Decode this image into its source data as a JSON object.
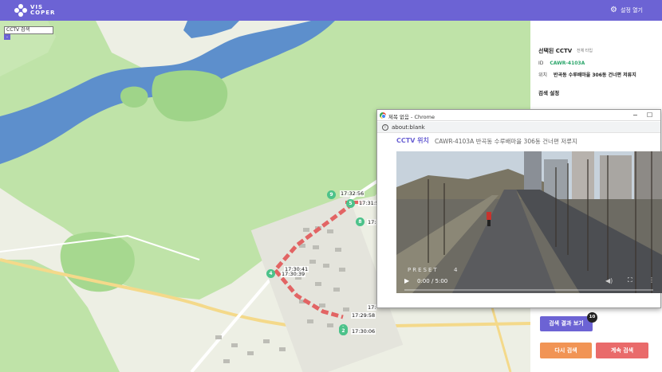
{
  "header": {
    "logo_line1": "VIS",
    "logo_line2": "COPER",
    "settings_label": "설정 열기"
  },
  "map": {
    "search_value": "CCTV 검색",
    "search_button": "-",
    "markers": [
      "9",
      "5",
      "8",
      "4",
      "3",
      "1",
      "2"
    ],
    "time_labels": [
      "17:32:56",
      "17:31:5",
      "17:",
      "17:30:41",
      "17:30:39",
      "17:29:58",
      "17:30:06",
      "17:"
    ]
  },
  "panel": {
    "selected_title": "선택된 CCTV",
    "selected_sub": "전체 타입",
    "id_label": "ID",
    "id_value": "CAWR-4103A",
    "loc_label": "위치",
    "loc_value": "반곡동 수루배마을 306동 건너편 저류지",
    "search_settings": "검색 설정",
    "results_button": "검색 결과 보기",
    "results_count": "10",
    "retry_button": "다시 검색",
    "continue_button": "계속 검색"
  },
  "popup": {
    "window_title": "제목 없음 - Chrome",
    "url": "about:blank",
    "heading": "CCTV 위치",
    "heading_sub": "CAWR-4103A 반곡동 수루배마을 306동 건너편 저류지",
    "preset_label": "PRESET",
    "preset_number": "4",
    "time_display": "0:00 / 5:00"
  },
  "colors": {
    "brand": "#6c63d4",
    "marker": "#4cc28a",
    "route": "#e26464",
    "retry": "#f19455",
    "continue": "#e96b6b"
  }
}
